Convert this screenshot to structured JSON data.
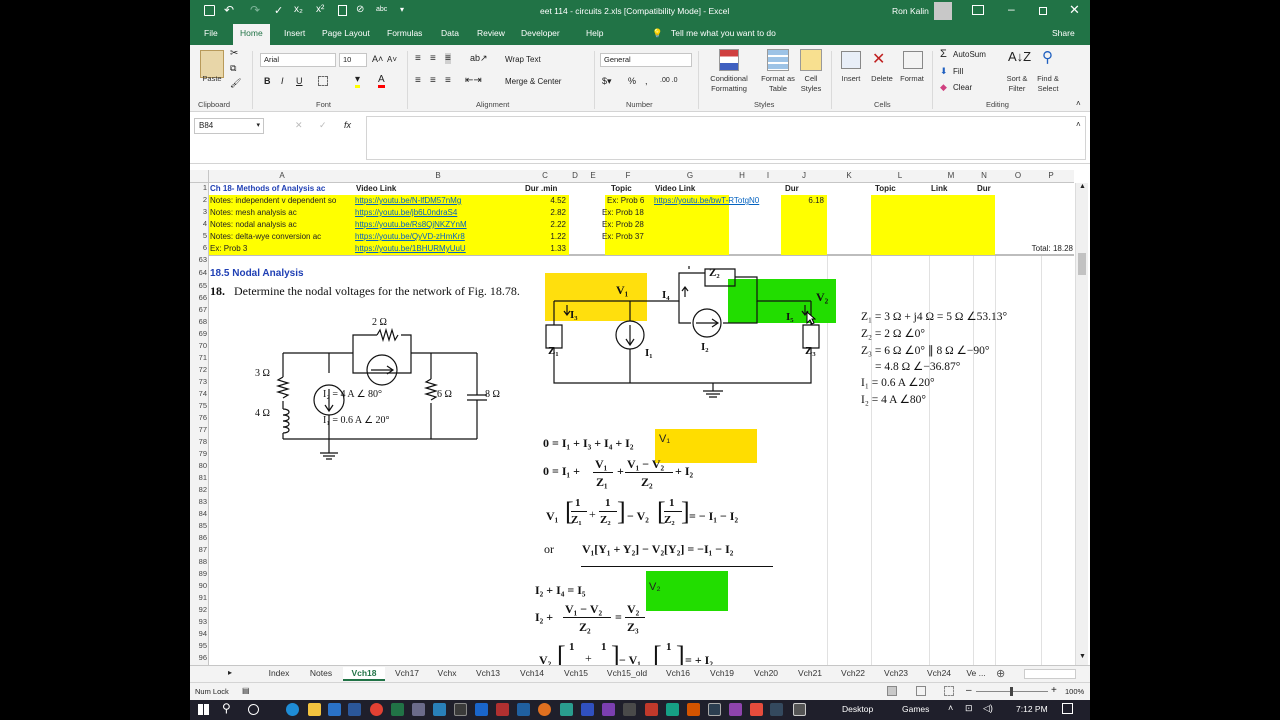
{
  "window": {
    "title": "eet 114 - circuits 2.xls  [Compatibility Mode]  -  Excel",
    "user": "Ron Kalin"
  },
  "ribbon_tabs": [
    "File",
    "Home",
    "Insert",
    "Page Layout",
    "Formulas",
    "Data",
    "Review",
    "Developer",
    "Help"
  ],
  "tell_me": "Tell me what you want to do",
  "share": "Share",
  "ribbon": {
    "clipboard": {
      "paste": "Paste",
      "label": "Clipboard"
    },
    "font": {
      "name": "Arial",
      "size": "10",
      "label": "Font",
      "bold": "B",
      "italic": "I",
      "underline": "U"
    },
    "alignment": {
      "wrap": "Wrap Text",
      "merge": "Merge & Center",
      "label": "Alignment"
    },
    "number": {
      "format": "General",
      "pct": "%",
      "comma": ",",
      "label": "Number"
    },
    "styles": {
      "cond": "Conditional Formatting",
      "table": "Format as Table",
      "cell": "Cell Styles",
      "label": "Styles"
    },
    "cells": {
      "insert": "Insert",
      "delete": "Delete",
      "format": "Format",
      "label": "Cells"
    },
    "editing": {
      "autosum": "AutoSum",
      "fill": "Fill",
      "clear": "Clear",
      "sort": "Sort & Filter",
      "find": "Find & Select",
      "label": "Editing"
    }
  },
  "namebox": "B84",
  "fx": "fx",
  "columns": [
    "A",
    "B",
    "C",
    "D",
    "E",
    "F",
    "G",
    "H",
    "I",
    "J",
    "K",
    "L",
    "M",
    "N",
    "O",
    "P"
  ],
  "rows": [
    "1",
    "2",
    "3",
    "4",
    "5",
    "6",
    "63",
    "64",
    "65",
    "66",
    "67",
    "68",
    "69",
    "70",
    "71",
    "72",
    "73",
    "74",
    "75",
    "76",
    "77",
    "78",
    "79",
    "80",
    "81",
    "82",
    "83",
    "84",
    "85",
    "86",
    "87",
    "88",
    "89",
    "90",
    "91",
    "92",
    "93",
    "94",
    "95",
    "96"
  ],
  "table": {
    "header": {
      "a": "Ch 18- Methods of Analysis ac",
      "b": "Video Link",
      "c": "Dur .min",
      "f": "Topic",
      "g": "Video Link",
      "j": "Dur",
      "l": "Topic",
      "m": "Link",
      "n": "Dur"
    },
    "rows": [
      {
        "a": "Notes: independent v dependent so",
        "b": "https://youtu.be/N-lfDM57nMg",
        "c": "4.52",
        "f": "Ex: Prob 6",
        "g": "https://youtu.be/bwT-RTotgN0",
        "j": "6.18"
      },
      {
        "a": "Notes: mesh analysis ac",
        "b": "https://youtu.be/jb6L0ndraS4",
        "c": "2.82",
        "f": "Ex: Prob 18"
      },
      {
        "a": "Notes: nodal analysis ac",
        "b": "https://youtu.be/Rs8QjNKZYnM",
        "c": "2.22",
        "f": "Ex: Prob 28"
      },
      {
        "a": "Notes: delta-wye conversion ac",
        "b": "https://youtu.be/QyVD-zHmKr8",
        "c": "1.22",
        "f": "Ex: Prob 37"
      },
      {
        "a": "Ex: Prob 3",
        "b": "https://youtu.be/1BHURMyUuU",
        "c": "1.33"
      }
    ],
    "total": "Total:  18.28"
  },
  "section_title": "18.5 Nodal Analysis",
  "problem": {
    "num": "18.",
    "text": "Determine the nodal voltages for the network of Fig. 18.78."
  },
  "fig": {
    "r2": "2 Ω",
    "r3": "3 Ω",
    "l4": "4 Ω",
    "i2": "I₂ = 4 A ∠ 80°",
    "i1": "I₁ = 0.6 A ∠ 20°",
    "r6": "6 Ω",
    "c8": "8 Ω"
  },
  "schem": {
    "v1": "V₁",
    "v2": "V₂",
    "z1": "Z₁",
    "z2": "Z₂",
    "z3": "Z₃",
    "i1": "I₁",
    "i2": "I₂",
    "i3": "I₃",
    "i4": "I₄",
    "i5": "I₅"
  },
  "values": [
    "Z₁ = 3 Ω + j4 Ω = 5 Ω ∠53.13°",
    "Z₂ = 2 Ω ∠0°",
    "Z₃ = 6 Ω ∠0° ∥ 8 Ω ∠−90°",
    "= 4.8 Ω ∠−36.87°",
    "I₁ = 0.6 A ∠20°",
    "I₂ = 4 A ∠80°"
  ],
  "eq": {
    "e1": "0 = I₁ + I₃ + I₄ + I₂",
    "v1tag": "V₁",
    "e2a": "0 = I₁ +",
    "e2b": "+ I₂",
    "fv1": "V₁",
    "fz1": "Z₁",
    "fv12": "V₁ − V₂",
    "fz2": "Z₂",
    "e3": "V₁",
    "e3b": "− V₂",
    "e3c": "= − I₁ − I₂",
    "one": "1",
    "z1": "Z₁",
    "z2": "Z₂",
    "or": "or",
    "e4": "V₁[Y₁ + Y₂] − V₂[Y₂] = −I₁ − I₂",
    "e5": "I₂ + I₄ = I₅",
    "v2tag": "V₂",
    "e6a": "I₂ +",
    "e6b": "=",
    "fv2": "V₂",
    "fz3": "Z₃",
    "e7": "V₂",
    "e7b": "− V₁",
    "e7c": "= + I₂"
  },
  "sheets": [
    "Index",
    "Notes",
    "Vch18",
    "Vch17",
    "Vchx",
    "Vch13",
    "Vch14",
    "Vch15",
    "Vch15_old",
    "Vch16",
    "Vch19",
    "Vch20",
    "Vch21",
    "Vch22",
    "Vch23",
    "Vch24",
    "Ve ..."
  ],
  "status": {
    "mode": "Num Lock",
    "zoom": "100%"
  },
  "taskbar": {
    "desktop": "Desktop",
    "games": "Games",
    "time": "7:12 PM"
  },
  "colors": {
    "excel_green": "#217346",
    "highlight_yellow": "#ffff00",
    "highlight_green": "#22dd00",
    "link": "#0563c1"
  }
}
